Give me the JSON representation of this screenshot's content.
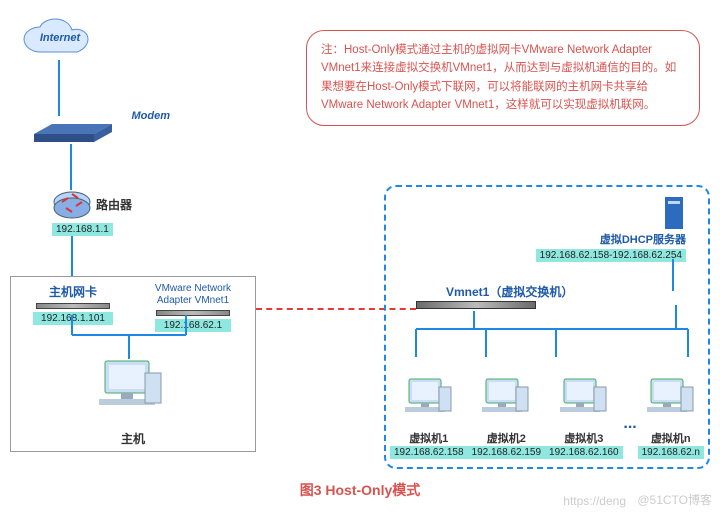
{
  "internet_label": "Internet",
  "modem_label": "Modem",
  "router": {
    "label": "路由器",
    "ip": "192.168.1.1"
  },
  "host": {
    "label": "主机",
    "nic1": {
      "label": "主机网卡",
      "ip": "192.168.1.101"
    },
    "nic2": {
      "label": "VMware Network Adapter VMnet1",
      "ip": "192.168.62.1"
    }
  },
  "vmnet": {
    "switch_label": "Vmnet1（虚拟交换机）",
    "dhcp": {
      "label": "虚拟DHCP服务器",
      "range": "192.168.62.158-192.168.62.254"
    },
    "vms": [
      {
        "name": "虚拟机1",
        "ip": "192.168.62.158"
      },
      {
        "name": "虚拟机2",
        "ip": "192.168.62.159"
      },
      {
        "name": "虚拟机3",
        "ip": "192.168.62.160"
      },
      {
        "name": "虚拟机n",
        "ip": "192.168.62.n"
      }
    ],
    "ellipsis": "..."
  },
  "note": "注：Host-Only模式通过主机的虚拟网卡VMware Network Adapter VMnet1来连接虚拟交换机VMnet1，从而达到与虚拟机通信的目的。如果想要在Host-Only模式下联网，可以将能联网的主机网卡共享给VMware Network Adapter VMnet1，这样就可以实现虚拟机联网。",
  "caption": "图3  Host-Only模式",
  "watermark": "@51CTO博客",
  "watermark_left": "https://deng"
}
